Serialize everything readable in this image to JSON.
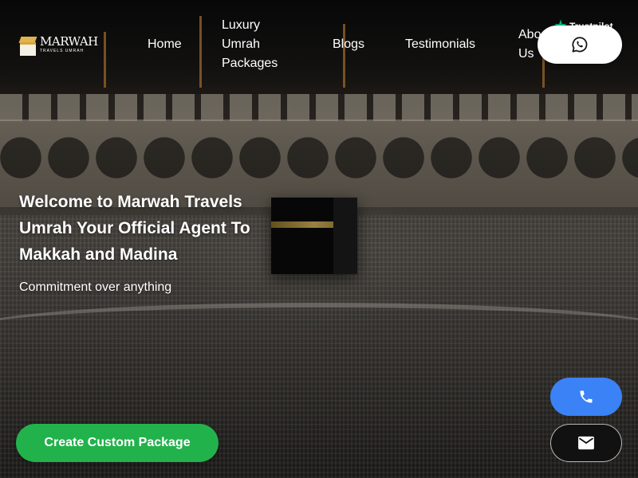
{
  "brand": {
    "name": "MARWAH",
    "tagline": "TRAVELS UMRAH"
  },
  "nav": {
    "home": "Home",
    "luxury_line1": "Luxury",
    "luxury_line2": "Umrah",
    "luxury_line3": "Packages",
    "blogs": "Blogs",
    "testimonials": "Testimonials",
    "about_line1": "Abo",
    "about_line2": "Us"
  },
  "trustpilot": {
    "label": "Trustpilot"
  },
  "hero": {
    "title": "Welcome to Marwah Travels Umrah Your Official Agent To Makkah and Madina",
    "subtitle": "Commitment over anything",
    "cta_label": "Create Custom Package"
  },
  "icons": {
    "whatsapp": "whatsapp-icon",
    "phone": "phone-icon",
    "mail": "mail-icon",
    "trustpilot_star": "star-icon"
  },
  "colors": {
    "cta": "#22b24c",
    "phone_button": "#3b82f6",
    "mail_button": "#111111",
    "whatsapp_button": "#ffffff",
    "trustpilot_star": "#00b67a"
  }
}
